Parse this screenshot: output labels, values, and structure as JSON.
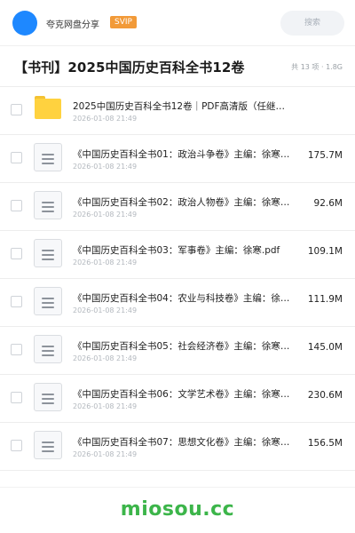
{
  "header": {
    "sharer_name": "夸克网盘分享",
    "badge": "SVIP",
    "search_placeholder": "搜索"
  },
  "share": {
    "title": "【书刊】2025中国历史百科全书12卷",
    "meta": "共 13 项 · 1.8G"
  },
  "files": [
    {
      "type": "folder",
      "name": "2025中国历史百科全书12卷｜PDF高清版（任继…",
      "date": "2026-01-08 21:49",
      "size": ""
    },
    {
      "type": "file",
      "name": "《中国历史百科全书01：政治斗争卷》主编：徐寒.p…",
      "date": "2026-01-08 21:49",
      "size": "175.7M"
    },
    {
      "type": "file",
      "name": "《中国历史百科全书02：政治人物卷》主编：徐寒.p…",
      "date": "2026-01-08 21:49",
      "size": "92.6M"
    },
    {
      "type": "file",
      "name": "《中国历史百科全书03：军事卷》主编：徐寒.pdf",
      "date": "2026-01-08 21:49",
      "size": "109.1M"
    },
    {
      "type": "file",
      "name": "《中国历史百科全书04：农业与科技卷》主编：徐寒.…",
      "date": "2026-01-08 21:49",
      "size": "111.9M"
    },
    {
      "type": "file",
      "name": "《中国历史百科全书05：社会经济卷》主编：徐寒.p…",
      "date": "2026-01-08 21:49",
      "size": "145.0M"
    },
    {
      "type": "file",
      "name": "《中国历史百科全书06：文学艺术卷》主编：徐寒.p…",
      "date": "2026-01-08 21:49",
      "size": "230.6M"
    },
    {
      "type": "file",
      "name": "《中国历史百科全书07：思想文化卷》主编：徐寒.p…",
      "date": "2026-01-08 21:49",
      "size": "156.5M"
    }
  ],
  "watermark": "miosou.cc"
}
